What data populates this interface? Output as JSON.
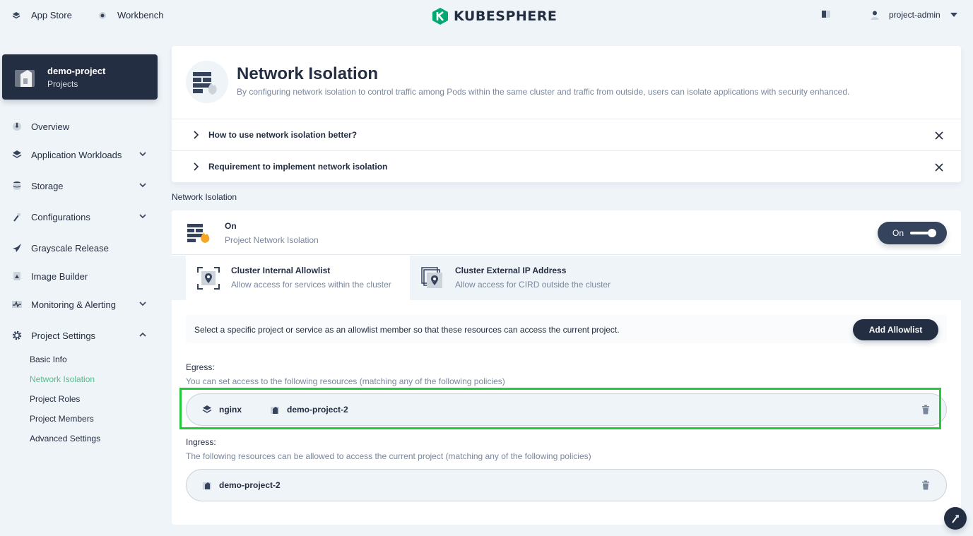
{
  "topbar": {
    "app_store": "App Store",
    "workbench": "Workbench",
    "logo_text": "KUBESPHERE",
    "user": "project-admin"
  },
  "project": {
    "name": "demo-project",
    "type": "Projects"
  },
  "nav": {
    "overview": "Overview",
    "app_workloads": "Application Workloads",
    "storage": "Storage",
    "configurations": "Configurations",
    "grayscale": "Grayscale Release",
    "image_builder": "Image Builder",
    "monitoring": "Monitoring & Alerting",
    "project_settings": "Project Settings",
    "sub": {
      "basic_info": "Basic Info",
      "network_isolation": "Network Isolation",
      "project_roles": "Project Roles",
      "project_members": "Project Members",
      "advanced_settings": "Advanced Settings"
    }
  },
  "banner": {
    "title": "Network Isolation",
    "description": "By configuring network isolation to control traffic among Pods within the same cluster and traffic from outside, users can isolate applications with security enhanced."
  },
  "tips": [
    "How to use network isolation better?",
    "Requirement to implement network isolation"
  ],
  "section_title": "Network Isolation",
  "isolation": {
    "status": "On",
    "subtitle": "Project Network Isolation",
    "toggle_label": "On",
    "toggle_on": true
  },
  "tabs": [
    {
      "title": "Cluster Internal Allowlist",
      "desc": "Allow access for services within the cluster"
    },
    {
      "title": "Cluster External IP Address",
      "desc": "Allow access for CIRD outside the cluster"
    }
  ],
  "notice": {
    "text": "Select a specific project or service as an allowlist member so that these resources can access the current project.",
    "button": "Add Allowlist"
  },
  "egress": {
    "label": "Egress:",
    "desc": "You can set access to the following resources (matching any of the following policies)",
    "service": "nginx",
    "project": "demo-project-2"
  },
  "ingress": {
    "label": "Ingress:",
    "desc": "The following resources can be allowed to access the current project (matching any of the following policies)",
    "project": "demo-project-2"
  },
  "colors": {
    "accent": "#55bc8a",
    "dark": "#242e42",
    "highlight": "#23c93a"
  }
}
